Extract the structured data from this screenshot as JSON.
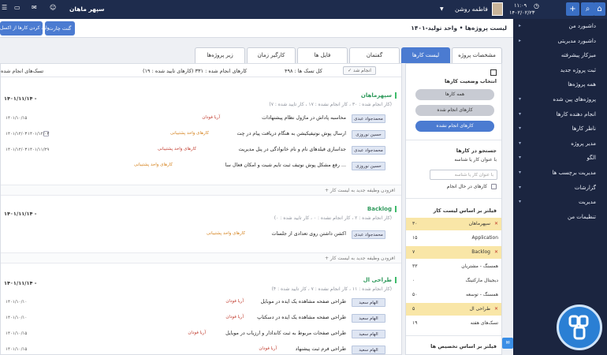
{
  "topbar": {
    "user_name": "فاطمه روشن",
    "time": "۱۱:۰۹",
    "date": "۱۴۰۲/۰۲/۲۳",
    "company": "سپهر ماهان"
  },
  "subheader": {
    "title": "لیست پروژه‌ها • واحد تولید-۱۴۰۱",
    "gantt_button": "گنت چارت",
    "import_button": "وارد کردن کارها از اکسل"
  },
  "tabs": [
    {
      "label": "مشخصات پروژه",
      "active": false
    },
    {
      "label": "لیست کارها",
      "active": true
    },
    {
      "label": "گفتمان",
      "active": false
    },
    {
      "label": "فایل ها",
      "active": false
    },
    {
      "label": "کارگیر زمان",
      "active": false
    },
    {
      "label": "زیر پروژه‌ها",
      "active": false
    }
  ],
  "summary": {
    "total": "کل تسک ها : ۴۹۸",
    "done": "کارهای انجام شده : ۳۳۱ (کارهای تایید شده : ۱۹)",
    "assigned": "تسک‌های انجام شده",
    "done_button": "انجام شد"
  },
  "groups": [
    {
      "title": "سپهرماهان",
      "meta": "(کار انجام شده : ۳۰ ، کار انجام نشده : ۱۷ ، کار تایید شده : ۷)",
      "date": "۱۴۰۱/۱۱/۱۴ -",
      "tasks": [
        {
          "assignee": "محمدجواد عبدی",
          "title": "محاسبه پاداش در ماژول نظام پیشنهادات",
          "tag": "آریا فودان",
          "tag_color": "red",
          "date": "۱۴۰۱/۱۰/۱۵",
          "date2": ""
        },
        {
          "assignee": "حسین نوروزی",
          "title": "ارسال پوش نوتیفیکیشن به هنگام دریافت پیام در چت",
          "tag": "کارهای واحد پشتیبانی",
          "tag_color": "orange",
          "date": "۱۴۰۱/۱۲/۰۳",
          "date2": "۱۴۰۱/۱۲/۰۳"
        },
        {
          "assignee": "محمدجواد عبدی",
          "title": "جداسازی فیلدهای نام و نام خانوادگی در پنل مدیریت",
          "tag": "کارهای واحد پشتیبانی",
          "tag_color": "red",
          "date": "۱۴۰۱/۱۲/۰۳",
          "date2": "۱۴۰۱/۱۱/۲۹"
        },
        {
          "assignee": "حسین نوروزی",
          "title": "رفع مشکل پوش نوتیف ثبت تایم شیت و امکان فعال سا ...",
          "tag": "کارهای واحد پشتیبانی",
          "tag_color": "orange",
          "date": "",
          "date2": ""
        }
      ],
      "add_label": "+ افزودن وظیفه جدید به لیست کار"
    },
    {
      "title": "Backlog",
      "meta": "(کار انجام شده : ۲ ، کار انجام نشده : ۰ ، کار تایید شده : ۰)",
      "date": "۱۴۰۱/۱۱/۱۴ -",
      "tasks": [
        {
          "assignee": "محمدجواد عبدی",
          "title": "اکشن داشتن روی تعدادی از جلسات",
          "tag": "کارهای واحد پشتیبانی",
          "tag_color": "orange",
          "date": "",
          "date2": ""
        }
      ],
      "add_label": "+ افزودن وظیفه جدید به لیست کار"
    },
    {
      "title": "طراحی ال",
      "meta": "(کار انجام شده : ۱۱ ، کار انجام نشده : ۷ ، کار تایید شده : ۴)",
      "date": "۱۴۰۱/۱۱/۱۴ -",
      "tasks": [
        {
          "assignee": "الهام سعید",
          "title": "طراحی صفحه مشاهده یک ایده در موبایل",
          "tag": "آریا فودان",
          "tag_color": "red",
          "date": "۱۴۰۱/۱۰/۱۰",
          "date2": ""
        },
        {
          "assignee": "الهام سعید",
          "title": "طراحی صفحه مشاهده یک ایده در دسکتاپ",
          "tag": "آریا فودان",
          "tag_color": "red",
          "date": "۱۴۰۱/۱۰/۱۰",
          "date2": ""
        },
        {
          "assignee": "الهام سعید",
          "title": "طراحی صفحات مربوط به ثبت کاندادار و ارزیاب در موبایل",
          "tag": "آریا فودان",
          "tag_color": "red",
          "date": "۱۴۰۱/۱۰/۱۵",
          "date2": ""
        },
        {
          "assignee": "الهام سعید",
          "title": "طراحی فرم ثبت پیشنهاد",
          "tag": "آریا فودان",
          "tag_color": "red",
          "date": "۱۴۰۱/۱۰/۱۵",
          "date2": ""
        }
      ],
      "add_label": ""
    }
  ],
  "right_panel": {
    "status_title": "انتخاب وضعیت کارها",
    "status_buttons": [
      {
        "label": "همه کارها",
        "active": false
      },
      {
        "label": "کارهای انجام شده",
        "active": false
      },
      {
        "label": "کارهای انجام نشده",
        "active": true
      }
    ],
    "search_title": "جستجو در کارها",
    "search_subtitle": "با عنوان کار یا شناسه",
    "search_placeholder": "با عنوان کار یا شناسه",
    "in_progress_label": "کارهای در حال انجام",
    "filter_title": "فیلتر بر اساس لیست کار",
    "filters": [
      {
        "label": "سپهرماهان",
        "count": "۳۰",
        "highlight": true
      },
      {
        "label": "Application",
        "count": "۱۵",
        "highlight": false
      },
      {
        "label": "Backlog",
        "count": "۷",
        "highlight": true
      },
      {
        "label": "همسنگ - مشتریان",
        "count": "۳۳",
        "highlight": false
      },
      {
        "label": "دیجیتال مارکتینگ",
        "count": "۰",
        "highlight": false
      },
      {
        "label": "همسنگ - توسعه",
        "count": "۵۰",
        "highlight": false
      },
      {
        "label": "طراحی ال",
        "count": "۵",
        "highlight": true
      },
      {
        "label": "تسک‌های هفته",
        "count": "۱۹",
        "highlight": false
      }
    ],
    "filter_title2": "فیلتر بر اساس تخصیص ها"
  },
  "sidebar": {
    "items": [
      {
        "label": "داشبورد من",
        "chev": "▸"
      },
      {
        "label": "داشبورد مدیریتی",
        "chev": "▸"
      },
      {
        "label": "میزکار پیشرفته",
        "chev": ""
      },
      {
        "label": "ثبت پروژه جدید",
        "chev": ""
      },
      {
        "label": "همه پروژه‌ها",
        "chev": ""
      },
      {
        "label": "پروژه‌های پین شده",
        "chev": "▾"
      },
      {
        "label": "انجام دهنده کارها",
        "chev": "▾"
      },
      {
        "label": "ناظر کارها",
        "chev": "▾"
      },
      {
        "label": "مدیر پروژه",
        "chev": "▾"
      },
      {
        "label": "الگو",
        "chev": "▾"
      },
      {
        "label": "مدیریت برچسب ها",
        "chev": "▾"
      },
      {
        "label": "گزارشات",
        "chev": "▾"
      },
      {
        "label": "مدیریت",
        "chev": "▾"
      },
      {
        "label": "تنظیمات من",
        "chev": ""
      }
    ]
  }
}
